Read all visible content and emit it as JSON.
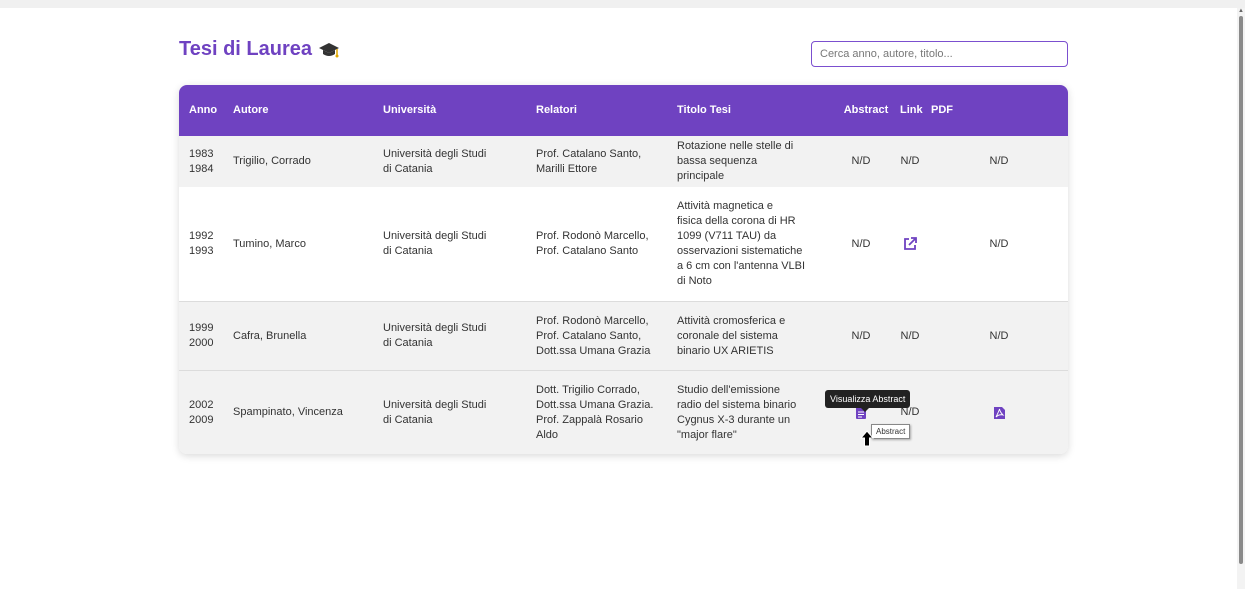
{
  "page": {
    "title": "Tesi di Laurea",
    "title_icon": "graduation-cap-icon"
  },
  "search": {
    "placeholder": "Cerca anno, autore, titolo..."
  },
  "table": {
    "headers": {
      "anno": "Anno",
      "autore": "Autore",
      "universita": "Università",
      "relatori": "Relatori",
      "titolo": "Titolo Tesi",
      "abstract": "Abstract",
      "link": "Link",
      "pdf": "PDF"
    },
    "rows": [
      {
        "anno": "1983\n1984",
        "autore": "Trigilio, Corrado",
        "universita": "Università degli Studi\ndi Catania",
        "relatori": "Prof. Catalano Santo,\nMarilli Ettore",
        "titolo": "Rotazione nelle stelle di\nbassa sequenza principale",
        "abstract": "N/D",
        "link": "N/D",
        "pdf": "N/D"
      },
      {
        "anno": "1992\n1993",
        "autore": "Tumino, Marco",
        "universita": "Università degli Studi\ndi Catania",
        "relatori": "Prof. Rodonò Marcello,\nProf. Catalano Santo",
        "titolo": "Attività magnetica e\nfisica della corona di HR\n1099 (V711 TAU) da\nosservazioni sistematiche\na 6 cm con l'antenna VLBI\ndi Noto",
        "abstract": "N/D",
        "link_icon": "external-link-icon",
        "pdf": "N/D"
      },
      {
        "anno": "1999\n2000",
        "autore": "Cafra, Brunella",
        "universita": "Università degli Studi\ndi Catania",
        "relatori": "Prof. Rodonò Marcello,\nProf. Catalano Santo,\nDott.ssa Umana Grazia",
        "titolo": "Attività cromosferica e\ncoronale del sistema\nbinario UX ARIETIS",
        "abstract": "N/D",
        "link": "N/D",
        "pdf": "N/D"
      },
      {
        "anno": "2002\n2009",
        "autore": "Spampinato, Vincenza",
        "universita": "Università degli Studi\ndi Catania",
        "relatori": "Dott. Trigilio Corrado,\nDott.ssa Umana Grazia.\nProf. Zappalà Rosario\nAldo",
        "titolo": "Studio dell'emissione\nradio del sistema binario\nCygnus X-3 durante un\n\"major flare\"",
        "abstract_icon": "document-icon",
        "link": "N/D",
        "pdf_icon": "pdf-file-icon"
      }
    ]
  },
  "tooltips": {
    "abstract_tooltip": "Visualizza Abstract",
    "native_title": "Abstract"
  },
  "colors": {
    "accent": "#6f42c1",
    "row_alt": "#f2f2f2"
  }
}
